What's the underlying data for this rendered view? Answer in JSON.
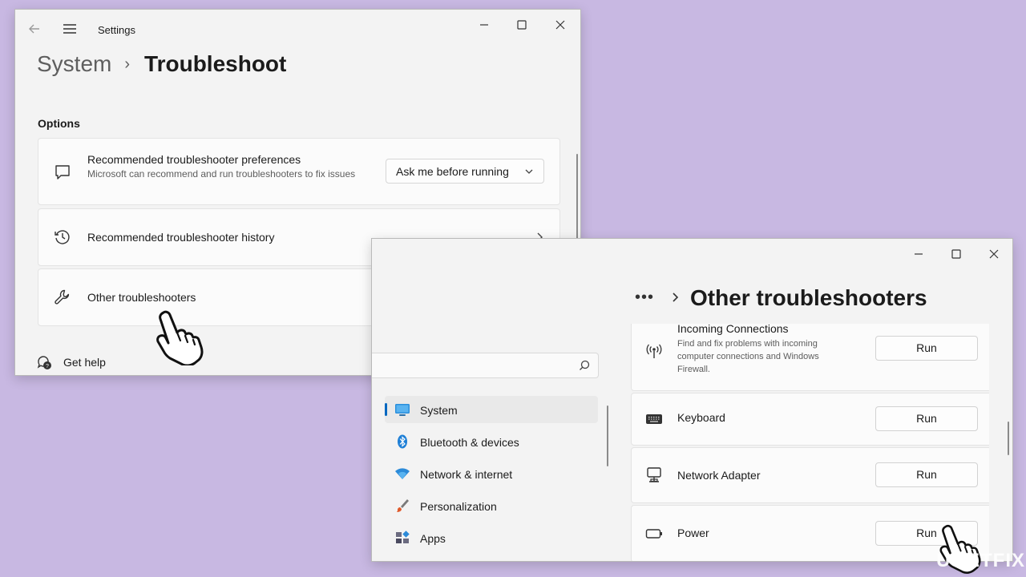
{
  "window1": {
    "title": "Settings",
    "breadcrumb": {
      "parent": "System",
      "separator": "›",
      "current": "Troubleshoot"
    },
    "section_label": "Options",
    "cards": [
      {
        "title": "Recommended troubleshooter preferences",
        "description": "Microsoft can recommend and run troubleshooters to fix issues",
        "dropdown_value": "Ask me before running",
        "icon": "chat-bubble-icon"
      },
      {
        "title": "Recommended troubleshooter history",
        "icon": "history-icon"
      },
      {
        "title": "Other troubleshooters",
        "icon": "wrench-icon"
      }
    ],
    "get_help": "Get help"
  },
  "window2": {
    "breadcrumb": {
      "ellipsis": "•••",
      "current": "Other troubleshooters"
    },
    "nav": [
      {
        "label": "System",
        "icon": "monitor-icon",
        "active": true
      },
      {
        "label": "Bluetooth & devices",
        "icon": "bluetooth-icon"
      },
      {
        "label": "Network & internet",
        "icon": "wifi-icon"
      },
      {
        "label": "Personalization",
        "icon": "brush-icon"
      },
      {
        "label": "Apps",
        "icon": "apps-icon"
      }
    ],
    "troubleshooters": [
      {
        "name": "Incoming Connections",
        "description": "Find and fix problems with incoming computer connections and Windows Firewall.",
        "button": "Run",
        "icon": "antenna-icon"
      },
      {
        "name": "Keyboard",
        "button": "Run",
        "icon": "keyboard-icon"
      },
      {
        "name": "Network Adapter",
        "button": "Run",
        "icon": "network-adapter-icon"
      },
      {
        "name": "Power",
        "button": "Run",
        "icon": "battery-icon"
      }
    ]
  },
  "watermark": "UGETFIX",
  "colors": {
    "background": "#c8b8e2",
    "accent": "#0067c0"
  }
}
